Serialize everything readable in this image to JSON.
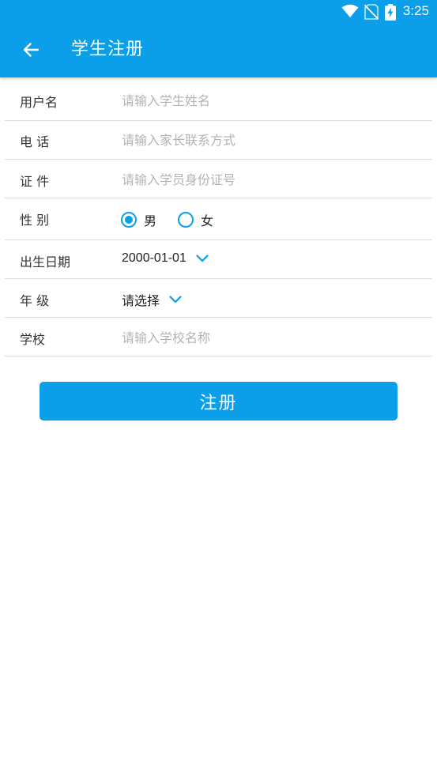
{
  "status_bar": {
    "time": "3:25",
    "icons": [
      "wifi-icon",
      "no-sim-icon",
      "battery-charging-icon"
    ]
  },
  "header": {
    "title": "学生注册",
    "back_icon": "arrow-left-icon",
    "background_color": "#0a9fe8"
  },
  "form": {
    "username": {
      "label": "用户名",
      "value": "",
      "placeholder": "请输入学生姓名"
    },
    "phone": {
      "label": "电 话",
      "value": "",
      "placeholder": "请输入家长联系方式"
    },
    "id_card": {
      "label": "证 件",
      "value": "",
      "placeholder": "请输入学员身份证号"
    },
    "gender": {
      "label": "性 别",
      "options": [
        {
          "label": "男",
          "selected": true
        },
        {
          "label": "女",
          "selected": false
        }
      ]
    },
    "birthdate": {
      "label": "出生日期",
      "value": "2000-01-01",
      "icon": "chevron-down-icon"
    },
    "grade": {
      "label": "年 级",
      "value": "请选择",
      "icon": "chevron-down-icon"
    },
    "school": {
      "label": "学校",
      "value": "",
      "placeholder": "请输入学校名称"
    }
  },
  "submit": {
    "label": "注册"
  },
  "colors": {
    "accent": "#0a9fe8",
    "divider": "#dcdcdc",
    "placeholder": "#b3b3b3",
    "text": "#333333"
  }
}
